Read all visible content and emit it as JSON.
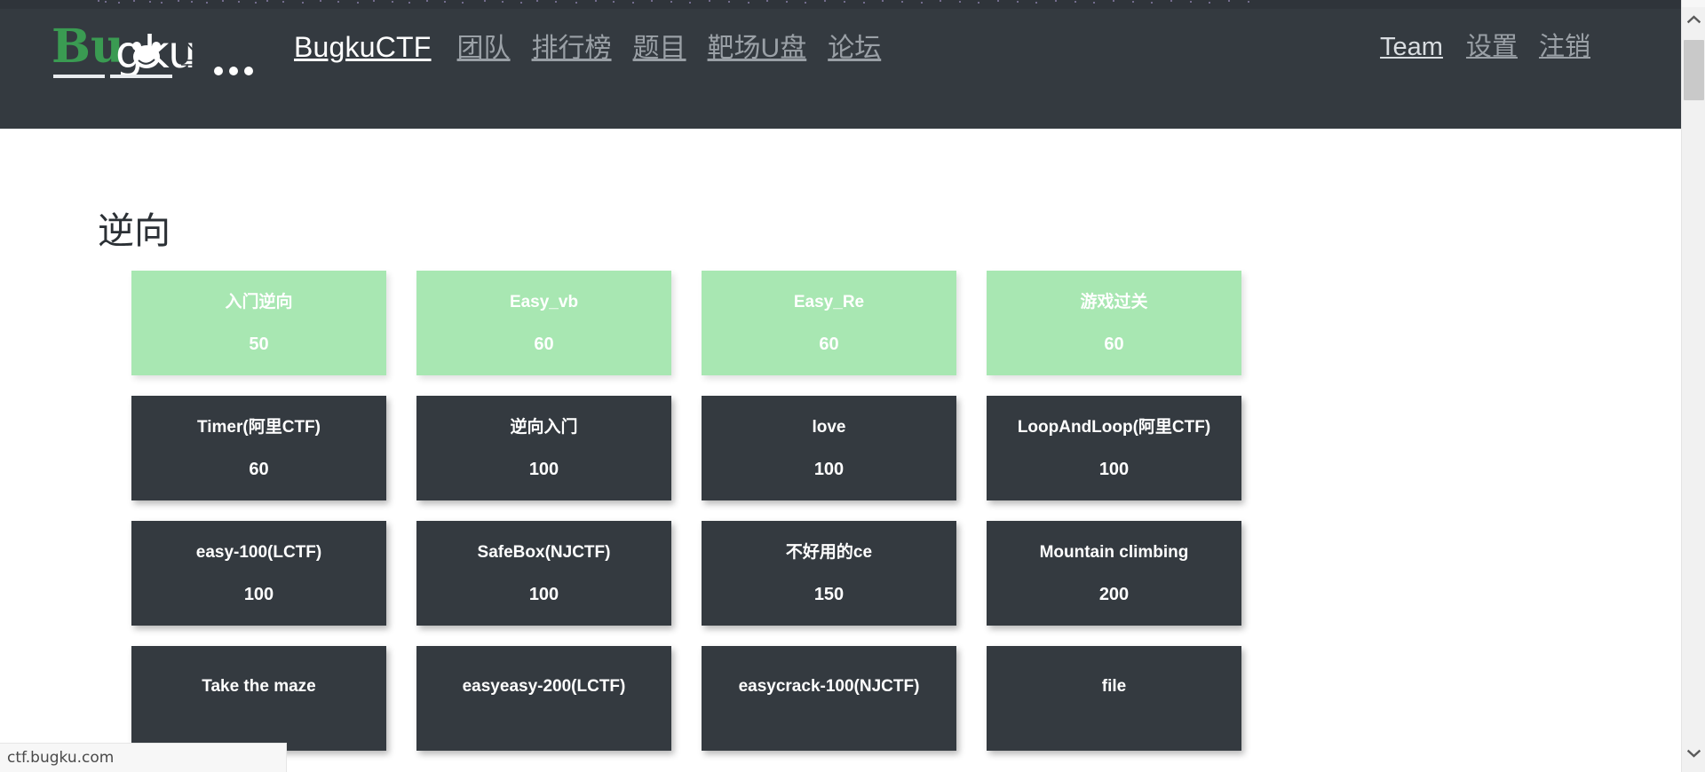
{
  "navbar": {
    "logo_text": "Bugku...",
    "logo_green_part": "Bu",
    "logo_white_part": "gku...",
    "brand": "BugkuCTF",
    "links": [
      {
        "label": "团队",
        "name": "nav-team-cn"
      },
      {
        "label": "排行榜",
        "name": "nav-leaderboard"
      },
      {
        "label": "题目",
        "name": "nav-challenges"
      },
      {
        "label": "靶场U盘",
        "name": "nav-range-usb"
      },
      {
        "label": "论坛",
        "name": "nav-forum"
      }
    ],
    "right_links": [
      {
        "label": "Team",
        "name": "nav-team"
      },
      {
        "label": "设置",
        "name": "nav-settings"
      },
      {
        "label": "注销",
        "name": "nav-logout"
      }
    ],
    "background_color": "#343a40",
    "link_color": "#9aa0a6"
  },
  "main": {
    "title": "逆向",
    "solved_color": "#a8e7b2",
    "unsolved_color": "#343a40",
    "challenges": [
      {
        "title": "入门逆向",
        "score": "50",
        "solved": true
      },
      {
        "title": "Easy_vb",
        "score": "60",
        "solved": true
      },
      {
        "title": "Easy_Re",
        "score": "60",
        "solved": true
      },
      {
        "title": "游戏过关",
        "score": "60",
        "solved": true
      },
      {
        "title": "Timer(阿里CTF)",
        "score": "60",
        "solved": false
      },
      {
        "title": "逆向入门",
        "score": "100",
        "solved": false
      },
      {
        "title": "love",
        "score": "100",
        "solved": false
      },
      {
        "title": "LoopAndLoop(阿里CTF)",
        "score": "100",
        "solved": false
      },
      {
        "title": "easy-100(LCTF)",
        "score": "100",
        "solved": false
      },
      {
        "title": "SafeBox(NJCTF)",
        "score": "100",
        "solved": false
      },
      {
        "title": "不好用的ce",
        "score": "150",
        "solved": false
      },
      {
        "title": "Mountain climbing",
        "score": "200",
        "solved": false
      },
      {
        "title": "Take the maze",
        "score": "",
        "solved": false
      },
      {
        "title": "easyeasy-200(LCTF)",
        "score": "",
        "solved": false
      },
      {
        "title": "easycrack-100(NJCTF)",
        "score": "",
        "solved": false
      },
      {
        "title": "file",
        "score": "",
        "solved": false
      }
    ]
  },
  "status_bar": {
    "url": "ctf.bugku.com"
  },
  "scrollbar": {
    "up_arrow": "chevron-up-icon",
    "down_arrow": "chevron-down-icon"
  }
}
